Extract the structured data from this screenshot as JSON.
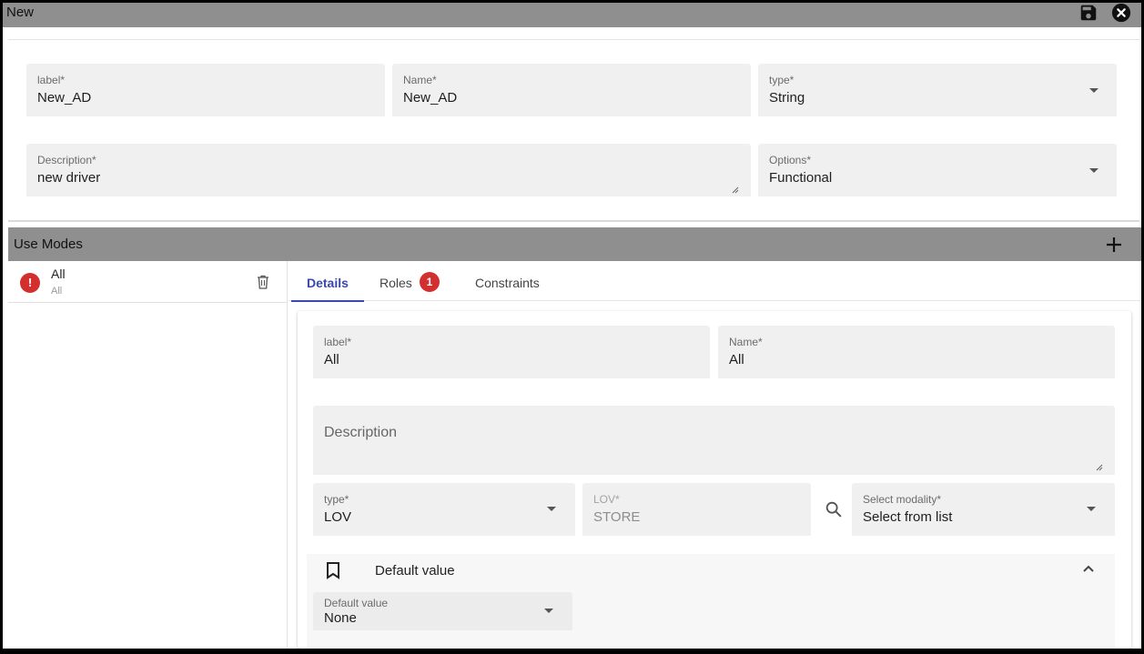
{
  "window": {
    "title": "New"
  },
  "form": {
    "label_field": {
      "label": "label*",
      "value": "New_AD"
    },
    "name_field": {
      "label": "Name*",
      "value": "New_AD"
    },
    "type_field": {
      "label": "type*",
      "value": "String"
    },
    "description_field": {
      "label": "Description*",
      "value": "new driver"
    },
    "options_field": {
      "label": "Options*",
      "value": "Functional"
    }
  },
  "use_modes": {
    "title": "Use Modes",
    "items": [
      {
        "badge": "!",
        "title": "All",
        "subtitle": "All"
      }
    ]
  },
  "tabs": [
    {
      "label": "Details",
      "active": true
    },
    {
      "label": "Roles",
      "badge": "1"
    },
    {
      "label": "Constraints"
    }
  ],
  "details": {
    "label_field": {
      "label": "label*",
      "value": "All"
    },
    "name_field": {
      "label": "Name*",
      "value": "All"
    },
    "description_field": {
      "label": "Description",
      "value": ""
    },
    "type_field": {
      "label": "type*",
      "value": "LOV"
    },
    "lov_field": {
      "label": "LOV*",
      "value": "STORE"
    },
    "modality_field": {
      "label": "Select modality*",
      "value": "Select from list"
    },
    "default_value_section": {
      "title": "Default value",
      "field": {
        "label": "Default value",
        "value": "None"
      }
    }
  },
  "colors": {
    "header_bar": "#8f8f8f",
    "field_bg": "#f0f0f0",
    "accent": "#3949ab",
    "error": "#d32f2f"
  }
}
